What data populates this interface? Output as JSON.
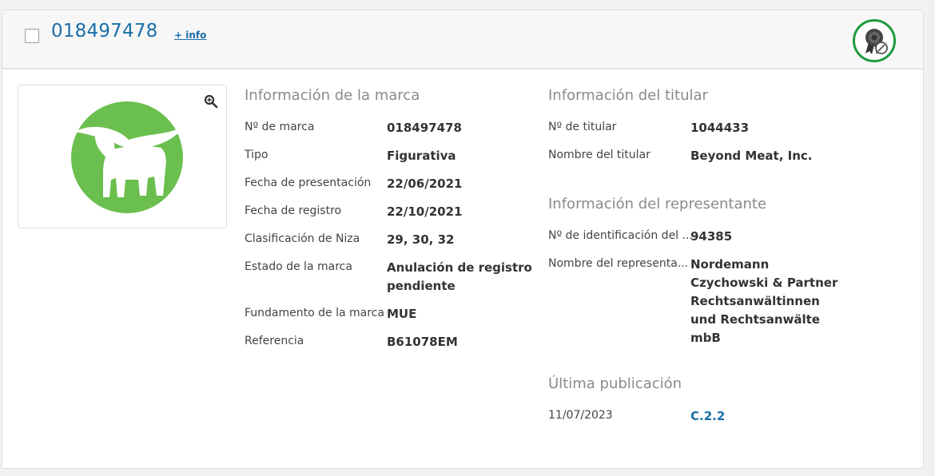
{
  "header": {
    "mark_number": "018497478",
    "info_link": "+ info",
    "status_icon": "award-badge-cancelled-icon"
  },
  "image": {
    "zoom_icon": "zoom-in-icon",
    "logo_icon": "bull-silhouette-logo",
    "logo_color": "#6bbf4e"
  },
  "brand_info": {
    "title": "Información de la marca",
    "rows": [
      {
        "label": "Nº de marca",
        "value": "018497478"
      },
      {
        "label": "Tipo",
        "value": "Figurativa"
      },
      {
        "label": "Fecha de presentación",
        "value": "22/06/2021"
      },
      {
        "label": "Fecha de registro",
        "value": "22/10/2021"
      },
      {
        "label": "Clasificación de Niza",
        "value": "29, 30, 32"
      },
      {
        "label": "Estado de la marca",
        "value": "Anulación de registro pendiente"
      },
      {
        "label": "Fundamento de la marca",
        "value": "MUE"
      },
      {
        "label": "Referencia",
        "value": "B61078EM"
      }
    ]
  },
  "owner_info": {
    "title": "Información del titular",
    "rows": [
      {
        "label": "Nº de titular",
        "value": "1044433"
      },
      {
        "label": "Nombre del titular",
        "value": "Beyond Meat, Inc."
      }
    ]
  },
  "rep_info": {
    "title": "Información del representante",
    "rows": [
      {
        "label": "Nº de identificación del ...",
        "value": "94385"
      },
      {
        "label": "Nombre del representa...",
        "value": "Nordemann Czychowski & Partner Rechtsanwältinnen und Rechtsanwälte mbB"
      }
    ]
  },
  "publication": {
    "title": "Última publicación",
    "date": "11/07/2023",
    "code": "C.2.2"
  },
  "colors": {
    "accent": "#1b6fa8",
    "badge_green": "#1e9b3d"
  }
}
